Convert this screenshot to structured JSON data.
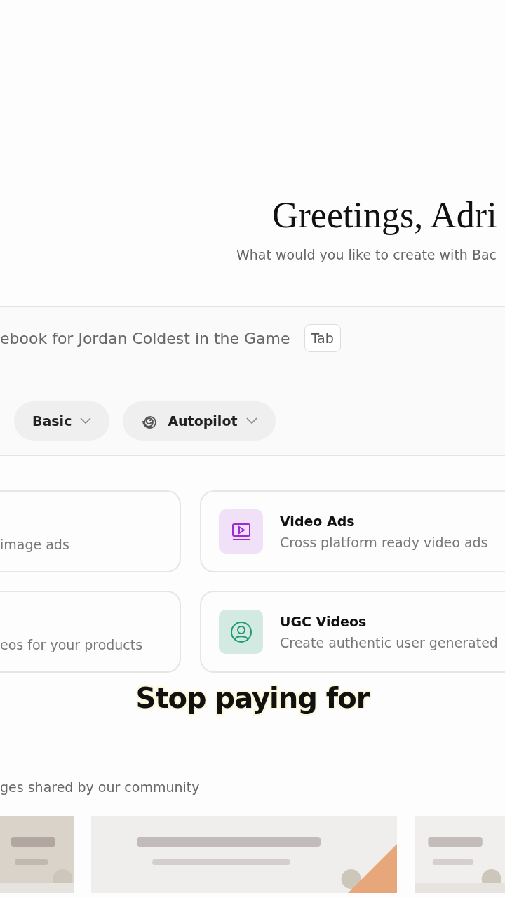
{
  "header": {
    "title": "Greetings, Adri",
    "subtitle": "What would you like to create with Bac"
  },
  "prompt": {
    "value": "ebook for Jordan Coldest in the Game",
    "key_hint": "Tab",
    "options": [
      {
        "label": "Basic",
        "kind": "plain"
      },
      {
        "label": "Autopilot",
        "kind": "autopilot"
      }
    ]
  },
  "cards": [
    {
      "kind": "partial",
      "description": "image ads"
    },
    {
      "kind": "video",
      "title": "Video Ads",
      "description": "Cross platform ready video ads",
      "color": "#9b2bd6"
    },
    {
      "kind": "partial",
      "description": "eos for your products"
    },
    {
      "kind": "user",
      "title": "UGC Videos",
      "description": "Create authentic user generated",
      "color": "#1f9a73"
    }
  ],
  "caption": "Stop paying for",
  "community": {
    "heading": "ges shared by our community",
    "images": [
      {
        "kind": "beige"
      },
      {
        "kind": "hand"
      },
      {
        "kind": "plain"
      }
    ]
  }
}
